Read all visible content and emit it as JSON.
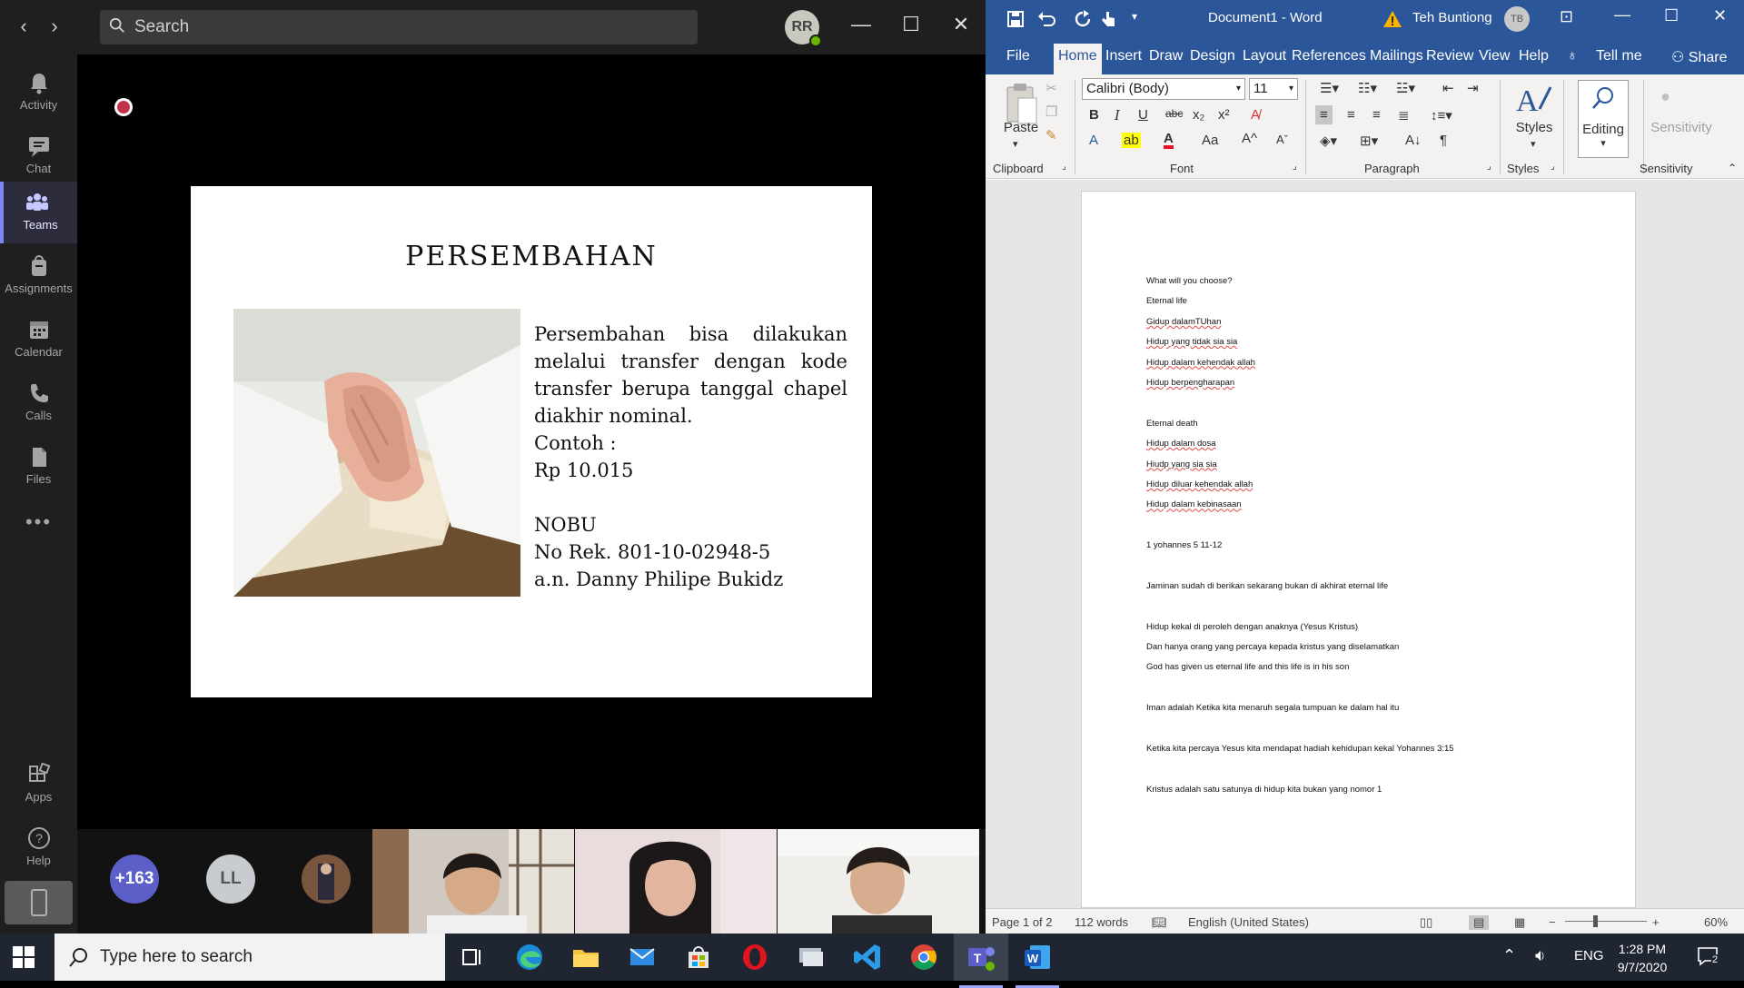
{
  "teams": {
    "search_placeholder": "Search",
    "avatar_initials": "RR",
    "rail": [
      {
        "label": "Activity",
        "icon": "bell-icon"
      },
      {
        "label": "Chat",
        "icon": "chat-icon"
      },
      {
        "label": "Teams",
        "icon": "teams-icon"
      },
      {
        "label": "Assignments",
        "icon": "assignments-icon"
      },
      {
        "label": "Calendar",
        "icon": "calendar-icon"
      },
      {
        "label": "Calls",
        "icon": "phone-icon"
      },
      {
        "label": "Files",
        "icon": "files-icon"
      },
      {
        "label": "...",
        "icon": "more-icon"
      },
      {
        "label": "Apps",
        "icon": "apps-icon"
      },
      {
        "label": "Help",
        "icon": "help-icon"
      }
    ],
    "active_rail": "Teams",
    "slide": {
      "title": "PERSEMBAHAN",
      "paragraph": "Persembahan bisa dilakukan melalui transfer dengan kode transfer berupa tanggal chapel diakhir nominal.",
      "example_label": "Contoh :",
      "example_value": "Rp 10.015",
      "bank": "NOBU",
      "account": "No Rek. 801-10-02948-5",
      "account_name": "a.n. Danny Philipe Bukidz"
    },
    "participants": {
      "more_count": "+163",
      "initials": "LL"
    }
  },
  "word": {
    "title": "Document1 - Word",
    "user_name": "Teh Buntiong",
    "user_initials": "TB",
    "tabs": [
      "File",
      "Home",
      "Insert",
      "Draw",
      "Design",
      "Layout",
      "References",
      "Mailings",
      "Review",
      "View",
      "Help",
      "Tell me",
      "Share"
    ],
    "active_tab": "Home",
    "font_name": "Calibri (Body)",
    "font_size": "11",
    "groups": {
      "clipboard": "Clipboard",
      "font": "Font",
      "paragraph": "Paragraph",
      "styles": "Styles",
      "sensitivity": "Sensitivity"
    },
    "buttons": {
      "paste": "Paste",
      "styles": "Styles",
      "editing": "Editing",
      "sensitivity": "Sensitivity"
    },
    "document_lines": [
      {
        "text": "What will you choose?"
      },
      {
        "text": "Eternal life"
      },
      {
        "text": "Gidup dalamTUhan",
        "squiggle": true
      },
      {
        "text": "Hidup yang tidak sia sia",
        "squiggle": true
      },
      {
        "text": "Hidup dalam kehendak allah",
        "squiggle": true
      },
      {
        "text": "Hidup berpengharapan",
        "squiggle": true
      },
      {
        "text": ""
      },
      {
        "text": "Eternal death"
      },
      {
        "text": "Hidup dalam dosa",
        "squiggle": true
      },
      {
        "text": "Hiudp yang sia sia",
        "squiggle": true
      },
      {
        "text": "Hidup diluar kehendak allah",
        "squiggle": true
      },
      {
        "text": "Hidup dalam kebinasaan",
        "squiggle": true
      },
      {
        "text": ""
      },
      {
        "text": "1 yohannes 5 11-12"
      },
      {
        "text": ""
      },
      {
        "text": "Jaminan sudah di berikan sekarang bukan di akhirat eternal life"
      },
      {
        "text": ""
      },
      {
        "text": "Hidup kekal di peroleh dengan anaknya (Yesus Kristus)"
      },
      {
        "text": "Dan hanya orang yang percaya kepada kristus yang diselamatkan"
      },
      {
        "text": "God has given us eternal life and this life is in his son"
      },
      {
        "text": ""
      },
      {
        "text": "Iman adalah Ketika kita menaruh segala tumpuan ke dalam hal itu"
      },
      {
        "text": ""
      },
      {
        "text": "Ketika kita percaya Yesus kita mendapat hadiah kehidupan kekal Yohannes 3:15"
      },
      {
        "text": ""
      },
      {
        "text": "Kristus adalah satu satunya di hidup kita bukan yang nomor 1"
      }
    ],
    "status": {
      "page": "Page 1 of 2",
      "words": "112 words",
      "language": "English (United States)",
      "zoom": "60%"
    }
  },
  "taskbar": {
    "search_placeholder": "Type here to search",
    "language": "ENG",
    "time": "1:28 PM",
    "date": "9/7/2020",
    "notification_count": "2"
  }
}
